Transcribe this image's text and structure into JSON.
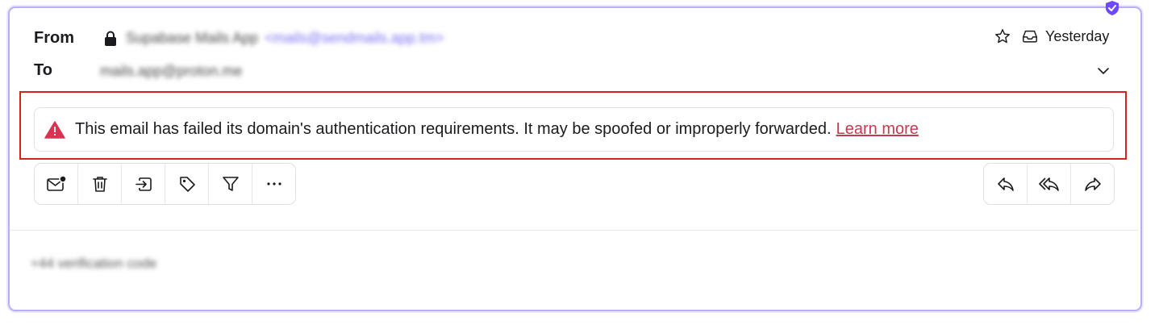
{
  "header": {
    "from_label": "From",
    "to_label": "To",
    "sender_name": "Supabase Mails App",
    "sender_email": "<mails@sendmails.app.tm>",
    "recipient": "mails.app@proton.me",
    "date": "Yesterday"
  },
  "warning": {
    "message": "This email has failed its domain's authentication requirements. It may be spoofed or improperly forwarded.",
    "link_label": "Learn more"
  },
  "toolbar_left": [
    {
      "name": "mark-unread-icon"
    },
    {
      "name": "trash-icon"
    },
    {
      "name": "move-to-icon"
    },
    {
      "name": "label-tag-icon"
    },
    {
      "name": "filter-icon"
    },
    {
      "name": "more-icon"
    }
  ],
  "toolbar_right": [
    {
      "name": "reply-icon"
    },
    {
      "name": "reply-all-icon"
    },
    {
      "name": "forward-icon"
    }
  ],
  "body": {
    "preview": "+44 verification code"
  },
  "colors": {
    "accent": "#6d4aff",
    "danger": "#dc3251",
    "warning_outline": "#d6231f",
    "link": "#c43a4f"
  }
}
